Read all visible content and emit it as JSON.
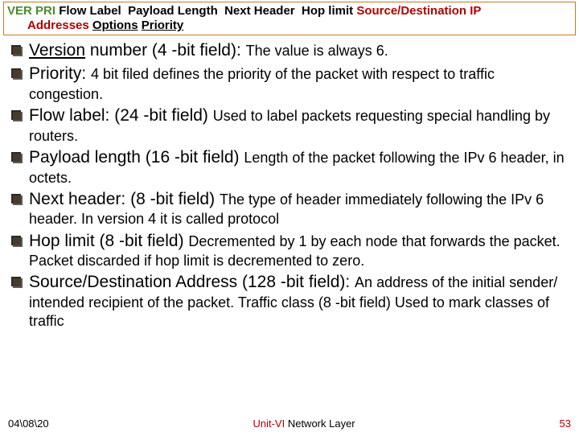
{
  "header": {
    "ver": "VER",
    "pri": "PRI",
    "flow": "Flow Label",
    "payload": "Payload Length",
    "next": "Next Header",
    "hop": "Hop limit",
    "srcdst": "Source/Destination IP",
    "addresses": "Addresses",
    "options": "Options",
    "priority": "Priority"
  },
  "items": [
    {
      "lead": "Version",
      "lead2": " number (4 -bit field): ",
      "rest": "The value is always 6."
    },
    {
      "lead": "Priority: ",
      "rest": "4 bit filed defines the priority of the packet with respect to traffic congestion."
    },
    {
      "lead": "Flow label: ",
      "lead2": " (24 -bit field) ",
      "rest": "Used to label packets requesting special handling by routers."
    },
    {
      "lead": "Payload length ",
      "lead2": "(16 -bit field) ",
      "rest": "Length of the packet following the IPv 6 header, in octets."
    },
    {
      "lead": "Next header: ",
      "lead2": " (8 -bit field) ",
      "rest": "The type of header immediately following the IPv 6 header.  In version 4 it is called protocol"
    },
    {
      "lead": "Hop limit ",
      "lead2": "(8 -bit field) ",
      "rest": "Decremented by 1 by each node that forwards the packet.  Packet discarded if hop limit is decremented to zero."
    },
    {
      "lead": "Source/Destination Address (128 -bit field):    ",
      "rest": "An address of the initial sender/ intended recipient of the packet. Traffic class (8 -bit field)  Used to mark classes of traffic"
    }
  ],
  "footer": {
    "date": "04\\08\\20",
    "unit_red": "Unit-VI",
    "unit_black": " Network Layer",
    "page": "53"
  }
}
